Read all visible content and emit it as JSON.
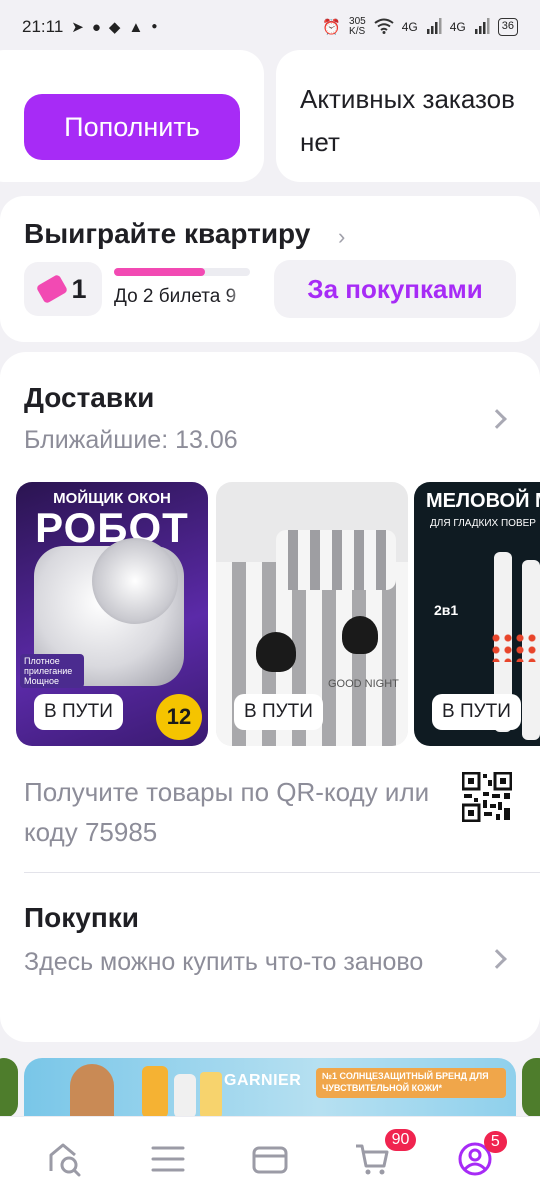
{
  "status_bar": {
    "time": "21:11",
    "speed": "305",
    "speed_unit": "K/S",
    "net1": "4G",
    "net2": "4G",
    "battery": "36"
  },
  "wallet": {
    "topup_label": "Пополнить"
  },
  "orders": {
    "empty_text": "Активных заказов нет"
  },
  "lottery": {
    "title": "Выиграйте квартиру",
    "tickets_count": "1",
    "progress_fraction": 0.67,
    "progress_text": "До 2 билета 9",
    "purchases_button": "За покупками",
    "accent": "#f24ab3"
  },
  "deliveries": {
    "title": "Доставки",
    "subtitle": "Ближайшие: 13.06",
    "items": [
      {
        "badge": "В ПУТИ",
        "header": "МОЙЩИК ОКОН",
        "headline": "РОБОТ",
        "tag1": "Плотное прилегание",
        "tag2": "Мощное",
        "seal": "12"
      },
      {
        "badge": "В ПУТИ",
        "print": "GOOD NIGHT"
      },
      {
        "badge": "В ПУТИ",
        "header": "МЕЛОВОЙ М",
        "sub": "ДЛЯ ГЛАДКИХ ПОВЕР",
        "label": "2в1"
      }
    ],
    "qr_text": "Получите товары по QR-коду или коду 75985"
  },
  "purchases": {
    "title": "Покупки",
    "subtitle": "Здесь можно купить что-то заново"
  },
  "banner": {
    "brand": "GARNIER",
    "badge_text": "№1 СОЛНЦЕЗАЩИТНЫЙ БРЕНД ДЛЯ ЧУВСТВИТЕЛЬНОЙ КОЖИ*"
  },
  "nav": {
    "cart_badge": "90",
    "profile_badge": "5"
  },
  "colors": {
    "accent": "#a72bf6",
    "badge": "#f0244f"
  }
}
